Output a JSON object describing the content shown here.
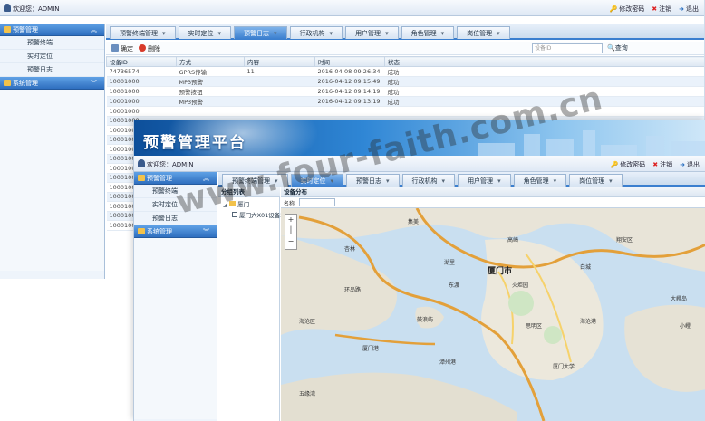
{
  "w1": {
    "welcome": "欢迎您：ADMIN",
    "actions": [
      {
        "icon": "key-icon",
        "label": "修改密码"
      },
      {
        "icon": "close-icon",
        "label": "注销"
      },
      {
        "icon": "arrow-right-icon",
        "label": "退出"
      }
    ],
    "sidebar": {
      "group1": "预警管理",
      "items": [
        "预警终端",
        "实时定位",
        "预警日志"
      ],
      "group2": "系统管理"
    },
    "tabs": [
      "预警终端管理",
      "实时定位",
      "预警日志",
      "行政机构",
      "用户管理",
      "角色管理",
      "岗位管理"
    ],
    "active_tab": "预警日志",
    "toolbar": {
      "confirm": "确定",
      "delete": "删除",
      "search_placeholder": "设备ID",
      "search_button": "查询"
    },
    "columns": [
      "设备ID",
      "方式",
      "内容",
      "时间",
      "状态"
    ],
    "rows": [
      [
        "74736574",
        "GPRS传输",
        "11",
        "2016-04-08 09:26:34",
        "成功"
      ],
      [
        "10001000",
        "MP3预警",
        "",
        "2016-04-12 09:15:49",
        "成功"
      ],
      [
        "10001000",
        "预警按钮",
        "",
        "2016-04-12 09:14:19",
        "成功"
      ],
      [
        "10001000",
        "MP3预警",
        "",
        "2016-04-12 09:13:19",
        "成功"
      ],
      [
        "10001000",
        "",
        "",
        "",
        ""
      ],
      [
        "10001000",
        "",
        "",
        "",
        ""
      ],
      [
        "10001000",
        "",
        "",
        "",
        ""
      ],
      [
        "10001000",
        "",
        "",
        "",
        ""
      ],
      [
        "10001000",
        "",
        "",
        "",
        ""
      ],
      [
        "10001000",
        "",
        "",
        "",
        ""
      ],
      [
        "10001000",
        "",
        "",
        "",
        ""
      ],
      [
        "10001000",
        "",
        "",
        "",
        ""
      ],
      [
        "10001000",
        "",
        "",
        "",
        ""
      ],
      [
        "10001000",
        "",
        "",
        "",
        ""
      ],
      [
        "10001000",
        "",
        "",
        "",
        ""
      ],
      [
        "10001000",
        "",
        "",
        "",
        ""
      ],
      [
        "10001000",
        "",
        "",
        "",
        ""
      ]
    ]
  },
  "w2": {
    "title": "预警管理平台",
    "welcome": "欢迎您：ADMIN",
    "actions": [
      {
        "icon": "key-icon",
        "label": "修改密码"
      },
      {
        "icon": "close-icon",
        "label": "注销"
      },
      {
        "icon": "arrow-right-icon",
        "label": "退出"
      }
    ],
    "sidebar": {
      "group1": "预警管理",
      "items": [
        "预警终端",
        "实时定位",
        "预警日志"
      ],
      "group2": "系统管理"
    },
    "tabs": [
      "预警终端管理",
      "实时定位",
      "预警日志",
      "行政机构",
      "用户管理",
      "角色管理",
      "岗位管理"
    ],
    "active_tab": "实时定位",
    "panel_left": "分组列表",
    "tree": [
      "厦门",
      "厦门六X01设备23号"
    ],
    "panel_right": "设备分布",
    "map_search_label": "名称",
    "map_labels": [
      {
        "t": "厦门市",
        "big": true
      },
      {
        "t": "海沧区"
      },
      {
        "t": "集美"
      },
      {
        "t": "杏林"
      },
      {
        "t": "湖里"
      },
      {
        "t": "鼓浪屿"
      },
      {
        "t": "翔安区"
      },
      {
        "t": "大嶝岛"
      },
      {
        "t": "小嶝"
      },
      {
        "t": "东渡"
      },
      {
        "t": "高崎"
      },
      {
        "t": "火炬园"
      },
      {
        "t": "厦门大学"
      },
      {
        "t": "思明区"
      },
      {
        "t": "白城"
      },
      {
        "t": "五缘湾"
      },
      {
        "t": "漳州港"
      },
      {
        "t": "厦门港"
      },
      {
        "t": "海沧港"
      },
      {
        "t": "环岛路"
      }
    ]
  },
  "watermark": "www.four-faith.com.cn"
}
